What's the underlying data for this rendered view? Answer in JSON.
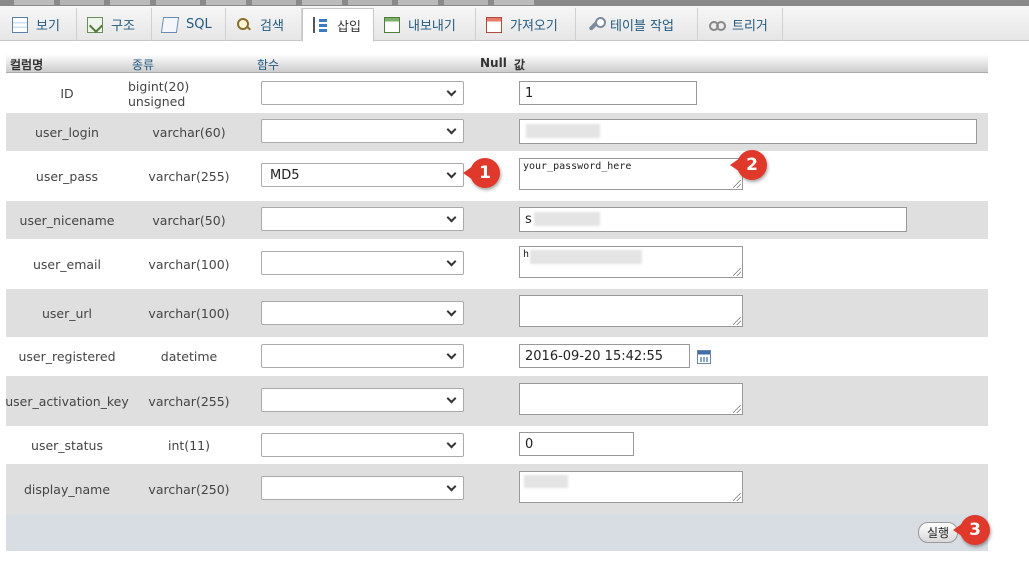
{
  "tabs": [
    {
      "label": "보기",
      "icon": "browse-icon"
    },
    {
      "label": "구조",
      "icon": "structure-icon"
    },
    {
      "label": "SQL",
      "icon": "sql-icon"
    },
    {
      "label": "검색",
      "icon": "search-icon"
    },
    {
      "label": "삽입",
      "icon": "insert-icon",
      "active": true
    },
    {
      "label": "내보내기",
      "icon": "export-icon"
    },
    {
      "label": "가져오기",
      "icon": "import-icon"
    },
    {
      "label": "테이블 작업",
      "icon": "wrench-icon"
    },
    {
      "label": "트리거",
      "icon": "trigger-icon"
    }
  ],
  "header": {
    "column": "컬럼명",
    "type": "종류",
    "function": "함수",
    "null": "Null",
    "value": "값"
  },
  "rows": [
    {
      "name": "ID",
      "type": "bigint(20) unsigned",
      "function": "",
      "value": "1"
    },
    {
      "name": "user_login",
      "type": "varchar(60)",
      "function": "",
      "value": ""
    },
    {
      "name": "user_pass",
      "type": "varchar(255)",
      "function": "MD5",
      "value": "your_password_here"
    },
    {
      "name": "user_nicename",
      "type": "varchar(50)",
      "function": "",
      "value": "s"
    },
    {
      "name": "user_email",
      "type": "varchar(100)",
      "function": "",
      "value": "h"
    },
    {
      "name": "user_url",
      "type": "varchar(100)",
      "function": "",
      "value": ""
    },
    {
      "name": "user_registered",
      "type": "datetime",
      "function": "",
      "value": "2016-09-20 15:42:55"
    },
    {
      "name": "user_activation_key",
      "type": "varchar(255)",
      "function": "",
      "value": ""
    },
    {
      "name": "user_status",
      "type": "int(11)",
      "function": "",
      "value": "0"
    },
    {
      "name": "display_name",
      "type": "varchar(250)",
      "function": "",
      "value": ""
    }
  ],
  "go_button": "실행",
  "callouts": [
    "1",
    "2",
    "3"
  ],
  "colors": {
    "callout": "#e0392b",
    "link": "#235a81",
    "footer": "#d7dde3",
    "row_alt": "#dfdfdf"
  }
}
